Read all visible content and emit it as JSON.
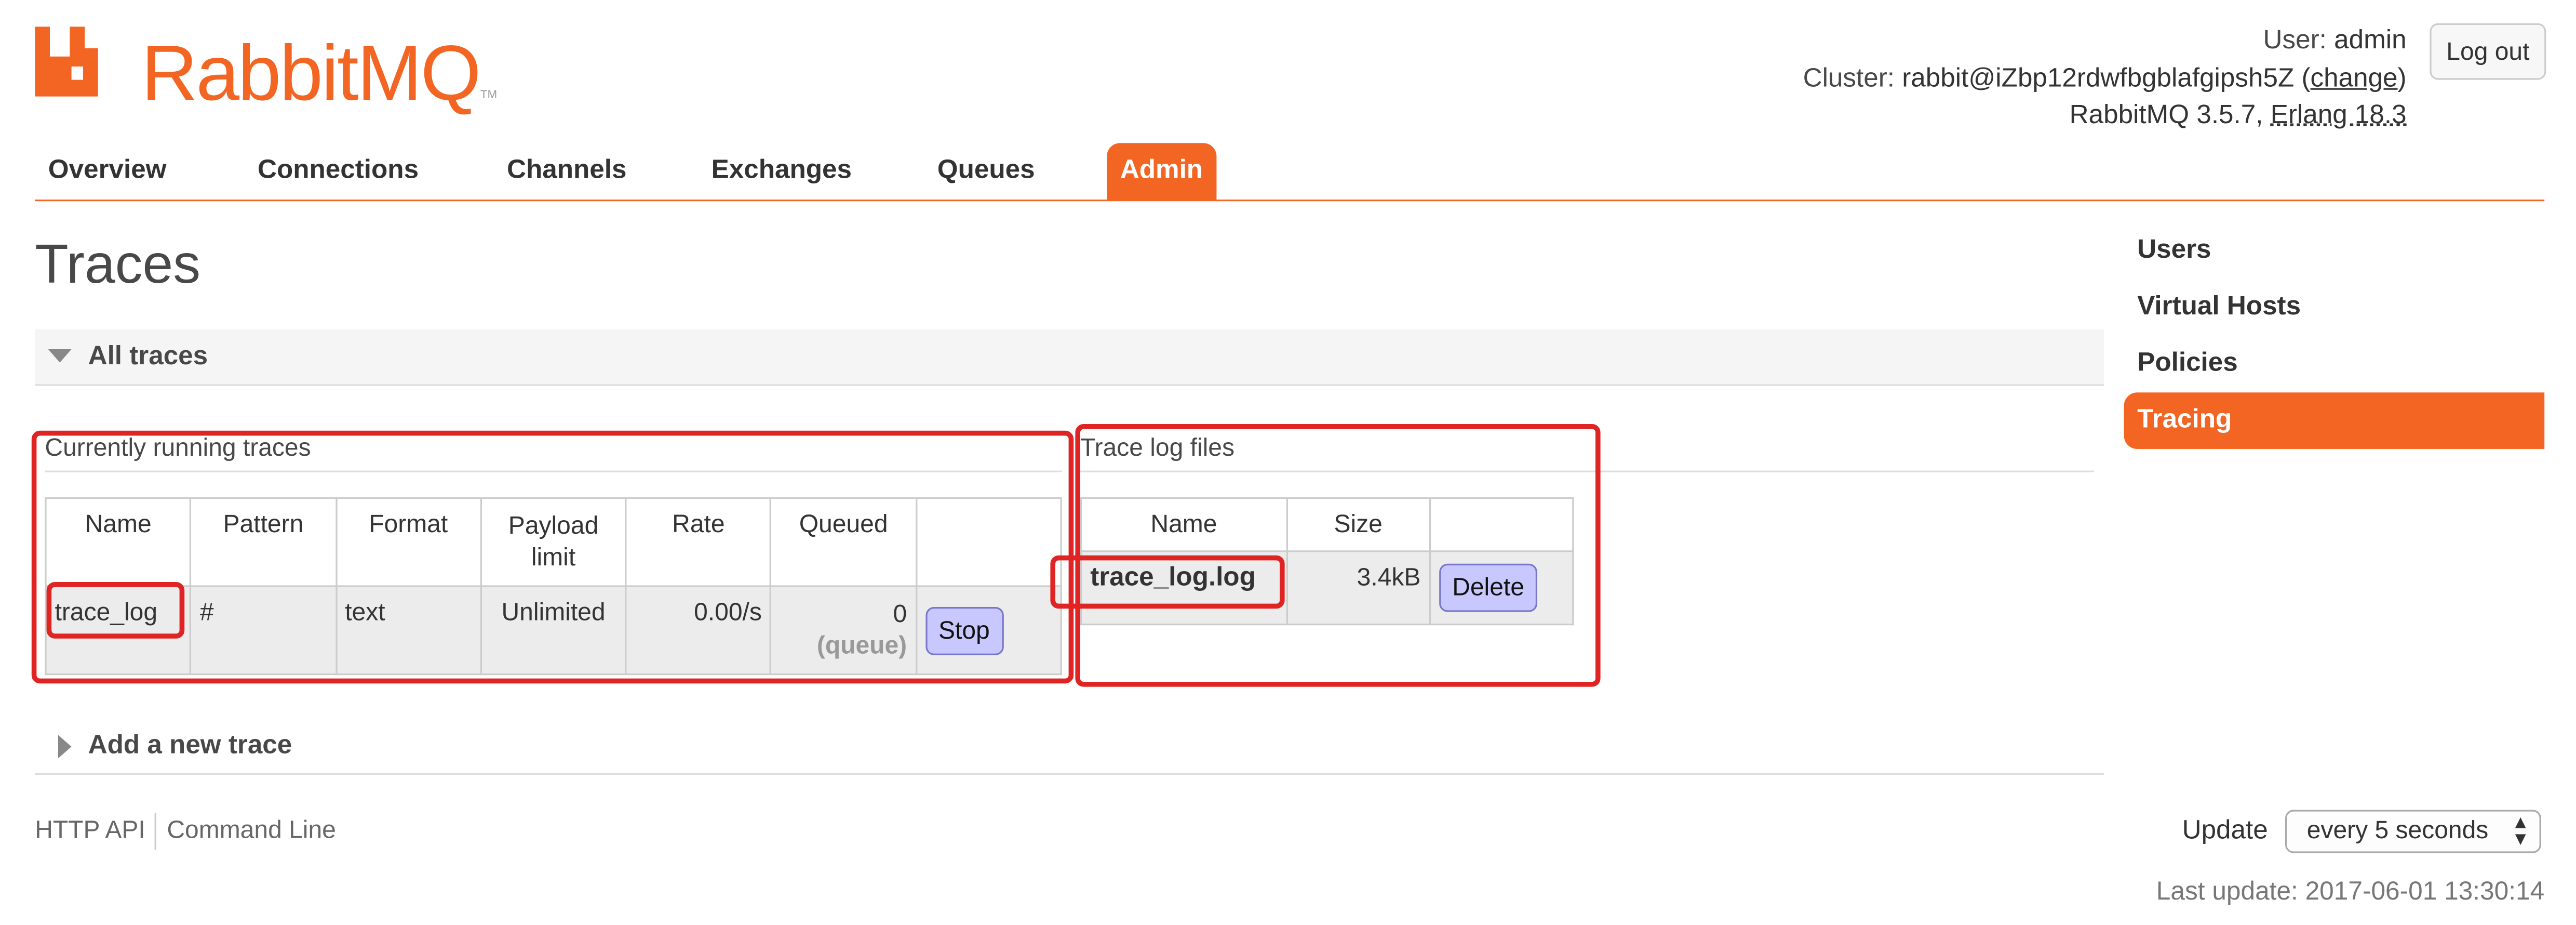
{
  "header": {
    "logo_text": "RabbitMQ",
    "logo_tm": "TM",
    "user_label": "User:",
    "user": "admin",
    "cluster_label": "Cluster:",
    "cluster": "rabbit@iZbp12rdwfbgblafgipsh5Z",
    "cluster_change": "change",
    "version": "RabbitMQ 3.5.7,",
    "erlang": "Erlang 18.3",
    "logout": "Log out"
  },
  "tabs": [
    "Overview",
    "Connections",
    "Channels",
    "Exchanges",
    "Queues",
    "Admin"
  ],
  "active_tab": "Admin",
  "page_title": "Traces",
  "right_menu": [
    "Users",
    "Virtual Hosts",
    "Policies",
    "Tracing"
  ],
  "active_right_menu": "Tracing",
  "all_traces": {
    "header": "All traces",
    "running": {
      "title": "Currently running traces",
      "columns": [
        "Name",
        "Pattern",
        "Format",
        "Payload limit",
        "Rate",
        "Queued",
        ""
      ],
      "row": {
        "name": "trace_log",
        "pattern": "#",
        "format": "text",
        "payload_limit": "Unlimited",
        "rate": "0.00/s",
        "queued": "0",
        "queued_sub": "(queue)",
        "action": "Stop"
      }
    },
    "logs": {
      "title": "Trace log files",
      "columns": [
        "Name",
        "Size",
        ""
      ],
      "row": {
        "name": "trace_log.log",
        "size": "3.4kB",
        "action": "Delete"
      }
    }
  },
  "add_trace": {
    "header": "Add a new trace"
  },
  "footer": {
    "links": [
      "HTTP API",
      "Command Line"
    ],
    "update_label": "Update",
    "update_value": "every 5 seconds",
    "last_update": "Last update: 2017-06-01 13:30:14"
  },
  "colors": {
    "brand": "#f36523",
    "button": "#c8c8ff",
    "highlight": "#e02424"
  }
}
